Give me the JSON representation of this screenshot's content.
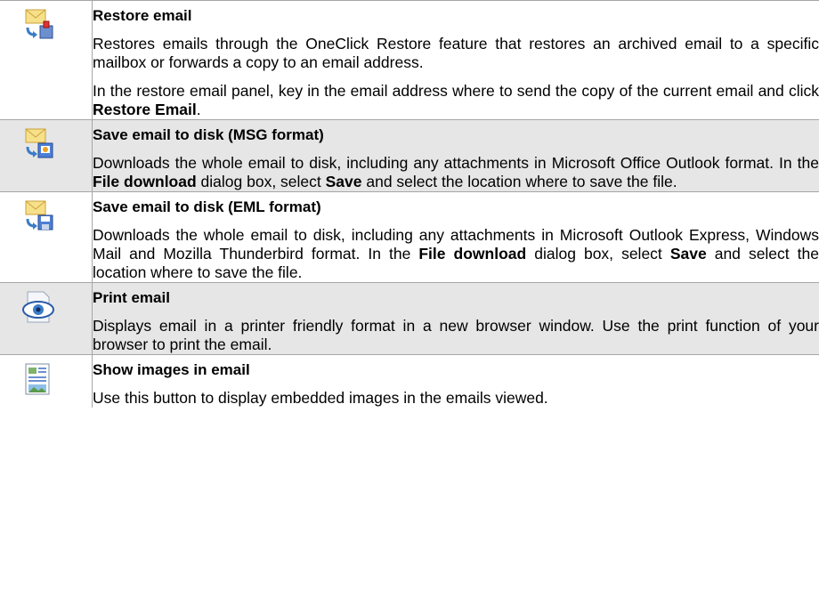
{
  "rows": [
    {
      "title": "Restore email",
      "icon": "email-restore-icon",
      "paragraphs": [
        [
          {
            "t": "Restores emails through the OneClick Restore feature that restores an archived email to a specific mailbox or forwards a copy to an email address."
          }
        ],
        [
          {
            "t": "In the restore email panel, key in the email address where to send the copy of the current email and click "
          },
          {
            "t": "Restore Email",
            "b": true
          },
          {
            "t": "."
          }
        ]
      ]
    },
    {
      "title": "Save email to disk (MSG format)",
      "icon": "save-msg-icon",
      "paragraphs": [
        [
          {
            "t": "Downloads the whole email to disk, including any attachments in Microsoft Office Outlook format. In the "
          },
          {
            "t": "File download",
            "b": true
          },
          {
            "t": " dialog box, select "
          },
          {
            "t": "Save",
            "b": true
          },
          {
            "t": " and select the location where to save the file."
          }
        ]
      ]
    },
    {
      "title": "Save email to disk (EML format)",
      "icon": "save-eml-icon",
      "paragraphs": [
        [
          {
            "t": "Downloads the whole email to disk, including any attachments in Microsoft Outlook Express, Windows Mail and Mozilla Thunderbird format. In the "
          },
          {
            "t": "File download",
            "b": true
          },
          {
            "t": " dialog box, select "
          },
          {
            "t": "Save",
            "b": true
          },
          {
            "t": " and select the location where to save the file."
          }
        ]
      ]
    },
    {
      "title": "Print email",
      "icon": "print-preview-eye-icon",
      "paragraphs": [
        [
          {
            "t": "Displays email in a printer friendly format in a new browser window. Use the print function of your browser to print the email."
          }
        ]
      ]
    },
    {
      "title": "Show images in email",
      "icon": "show-images-icon",
      "paragraphs": [
        [
          {
            "t": "Use this button to display embedded images in the emails viewed."
          }
        ]
      ]
    }
  ],
  "colors": {
    "shade": "#e6e6e6",
    "border": "#a6a6a6"
  }
}
